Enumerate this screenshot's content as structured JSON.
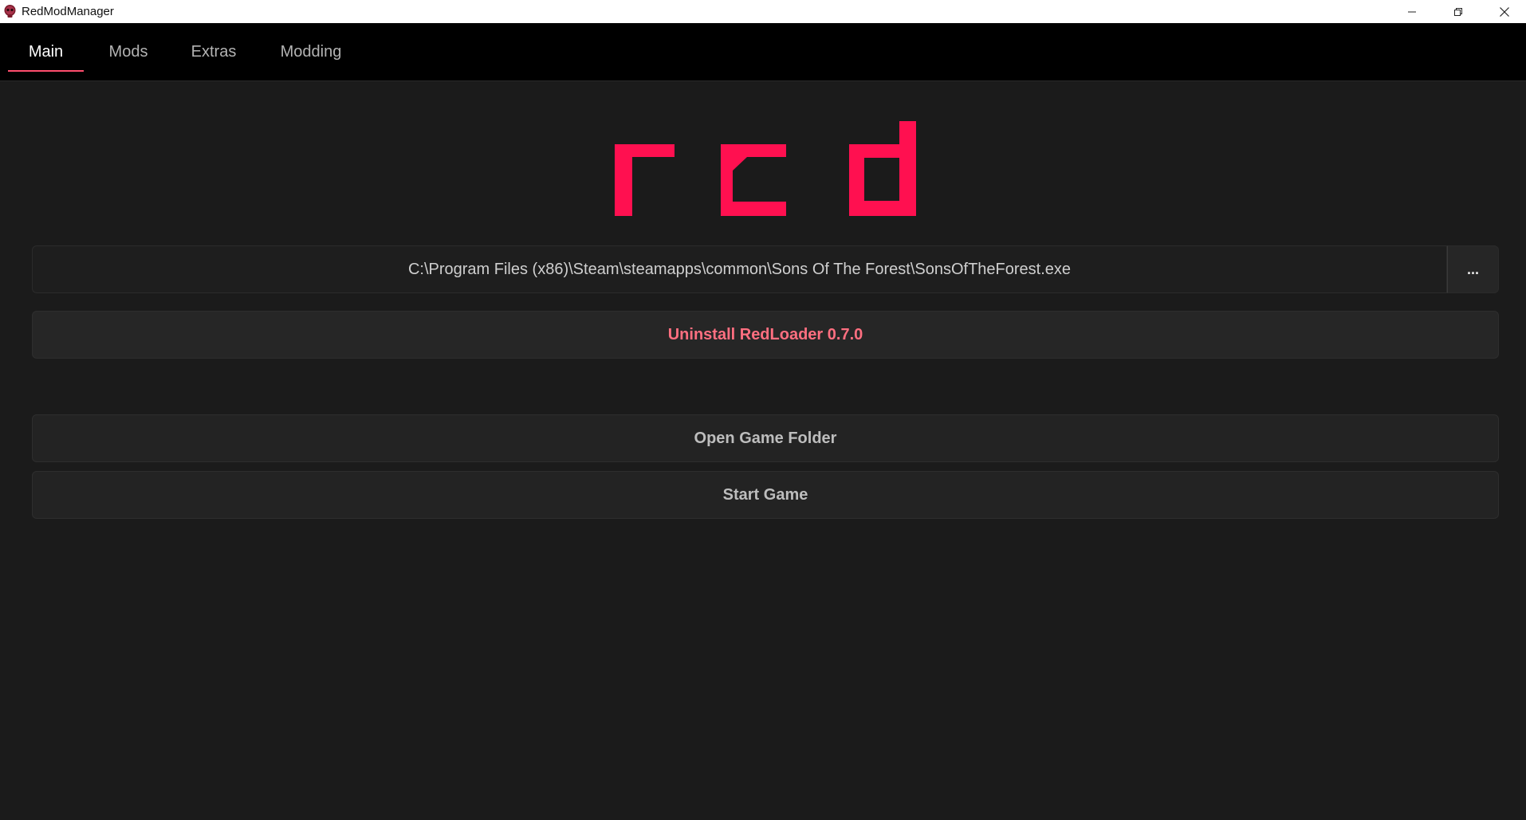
{
  "window": {
    "title": "RedModManager"
  },
  "icons": {
    "app": "skull-icon",
    "minimize": "minimize-icon",
    "maximize": "restore-icon",
    "close": "close-icon"
  },
  "nav": {
    "tabs": [
      {
        "label": "Main",
        "active": true
      },
      {
        "label": "Mods",
        "active": false
      },
      {
        "label": "Extras",
        "active": false
      },
      {
        "label": "Modding",
        "active": false
      }
    ]
  },
  "logo": {
    "color": "#ff1050"
  },
  "main": {
    "game_path": "C:\\Program Files (x86)\\Steam\\steamapps\\common\\Sons Of The Forest\\SonsOfTheForest.exe",
    "browse_label": "...",
    "uninstall_label": "Uninstall RedLoader 0.7.0",
    "open_folder_label": "Open Game Folder",
    "start_game_label": "Start Game"
  },
  "colors": {
    "accent": "#ff1050",
    "danger_text": "#ff6f80",
    "background": "#1b1b1b",
    "nav_background": "#000000"
  }
}
